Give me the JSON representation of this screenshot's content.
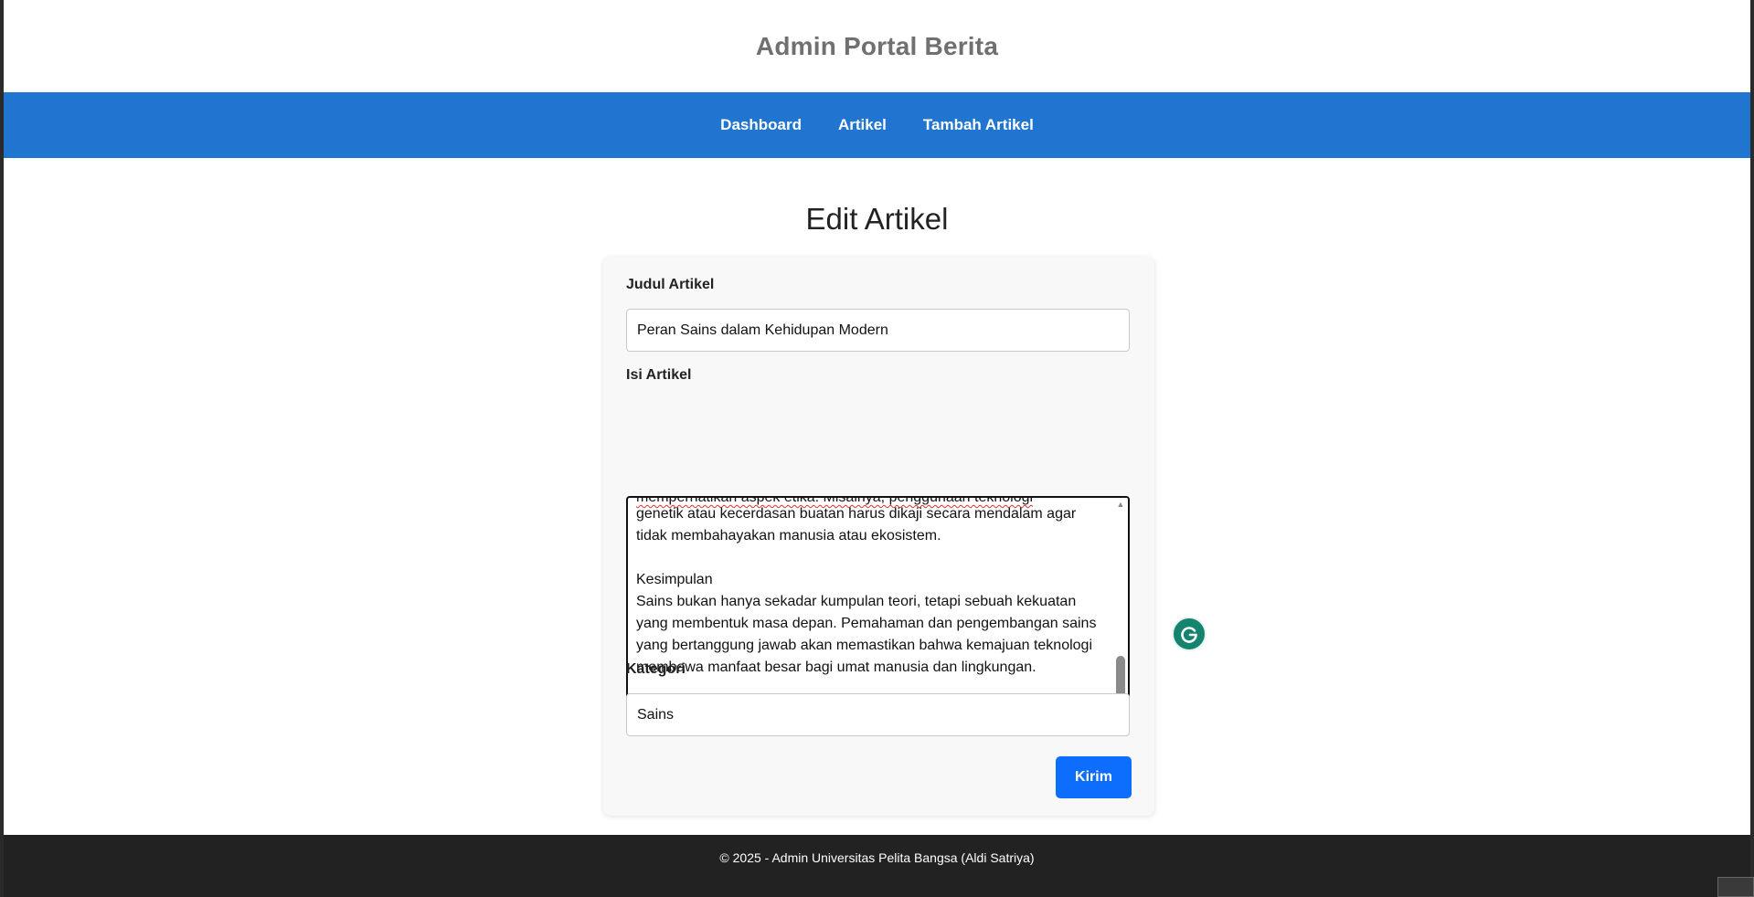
{
  "header": {
    "title": "Admin Portal Berita"
  },
  "nav": {
    "items": [
      {
        "label": "Dashboard"
      },
      {
        "label": "Artikel"
      },
      {
        "label": "Tambah Artikel"
      }
    ]
  },
  "main": {
    "heading": "Edit Artikel",
    "form": {
      "title_label": "Judul Artikel",
      "title_value": "Peran Sains dalam Kehidupan Modern",
      "content_label": "Isi Artikel",
      "content_visible_lines": [
        "genetik atau kecerdasan buatan harus dikaji secara mendalam agar",
        "tidak membahayakan manusia atau ekosistem.",
        "",
        "Kesimpulan",
        "Sains bukan hanya sekadar kumpulan teori, tetapi sebuah kekuatan",
        "yang membentuk masa depan. Pemahaman dan pengembangan sains",
        "yang bertanggung jawab akan memastikan bahwa kemajuan teknologi",
        "membawa manfaat besar bagi umat manusia dan lingkungan.",
        ""
      ],
      "category_label": "Kategori",
      "category_value": "Sains",
      "submit_label": "Kirim"
    }
  },
  "footer": {
    "text": "© 2025 - Admin Universitas Pelita Bangsa (Aldi Satriya)"
  },
  "colors": {
    "navbar": "#1f75cf",
    "submit": "#0d6efd",
    "footer": "#222222",
    "grammarly": "#15846e"
  },
  "icons": {
    "grammarly": "grammarly-icon",
    "scroll_up": "scroll-up-arrow-icon",
    "scroll_down": "scroll-down-arrow-icon",
    "resize": "resize-grip-icon"
  }
}
